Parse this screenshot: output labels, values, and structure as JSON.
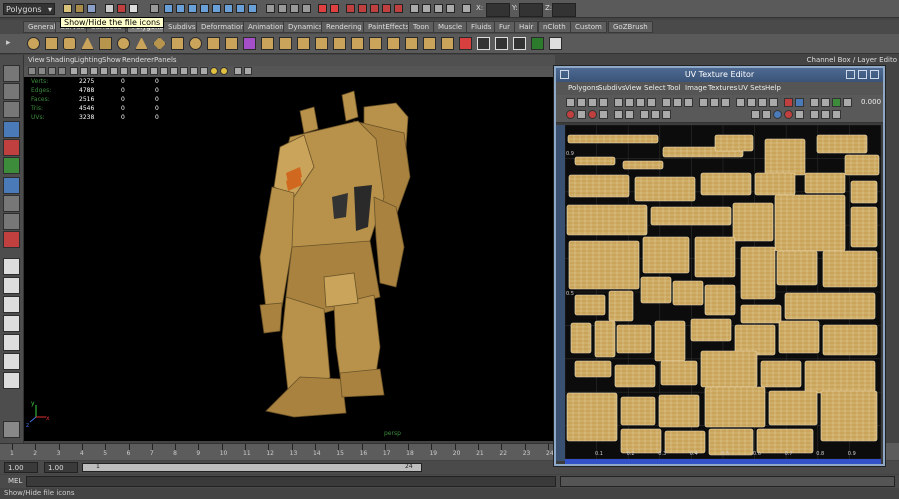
{
  "status_line": {
    "mode": "Polygons",
    "coord_labels": [
      "X:",
      "Y:",
      "Z:"
    ]
  },
  "tooltip": "Show/Hide the file icons",
  "shelf_tabs": [
    "General",
    "Curves",
    "Surfaces",
    "Polygons",
    "Subdivs",
    "Deformation",
    "Animation",
    "Dynamics",
    "Rendering",
    "PaintEffects",
    "Toon",
    "Muscle",
    "Fluids",
    "Fur",
    "Hair",
    "nCloth",
    "Custom",
    "GoZBrush"
  ],
  "active_shelf_tab": "Polygons",
  "channel_box_title": "Channel Box / Layer Edito",
  "viewport": {
    "menu": [
      "View",
      "Shading",
      "Lighting",
      "Show",
      "Renderer",
      "Panels"
    ],
    "hud": [
      {
        "label": "Verts:",
        "values": [
          "2275",
          "0",
          "0"
        ]
      },
      {
        "label": "Edges:",
        "values": [
          "4788",
          "0",
          "0"
        ]
      },
      {
        "label": "Faces:",
        "values": [
          "2516",
          "0",
          "0"
        ]
      },
      {
        "label": "Tris:",
        "values": [
          "4546",
          "0",
          "0"
        ]
      },
      {
        "label": "UVs:",
        "values": [
          "3238",
          "0",
          "0"
        ]
      }
    ],
    "camera": "persp",
    "axis_labels": [
      "y",
      "x",
      "z"
    ]
  },
  "uv_editor": {
    "title": "UV Texture Editor",
    "menu": [
      "Polygons",
      "Subdivs",
      "View",
      "Select",
      "Tool",
      "Image",
      "Textures",
      "UV Sets",
      "Help"
    ],
    "field_value": "0.000",
    "ruler_labels": [
      "0.1",
      "0.2",
      "0.3",
      "0.4",
      "0.5",
      "0.6",
      "0.7",
      "0.8",
      "0.9"
    ],
    "left_labels": [
      "0.9",
      "0.5"
    ],
    "colors": {
      "uv_shell_fill": "#c9a45a",
      "uv_wire": "#f2e6c4",
      "grid": "#2d2d2d",
      "title_bar": "#4e6a92",
      "border": "#3351c8"
    }
  },
  "timeline": {
    "ticks": [
      "1",
      "2",
      "3",
      "4",
      "5",
      "6",
      "7",
      "8",
      "9",
      "10",
      "11",
      "12",
      "13",
      "14",
      "15",
      "16",
      "17",
      "18",
      "19",
      "20",
      "21",
      "22",
      "23",
      "24"
    ]
  },
  "range": {
    "start": "1.00",
    "start_inner": "1.00",
    "current": "1",
    "end_inner": "24"
  },
  "command_line": {
    "label": "MEL"
  },
  "help_line": "Show/Hide file icons"
}
